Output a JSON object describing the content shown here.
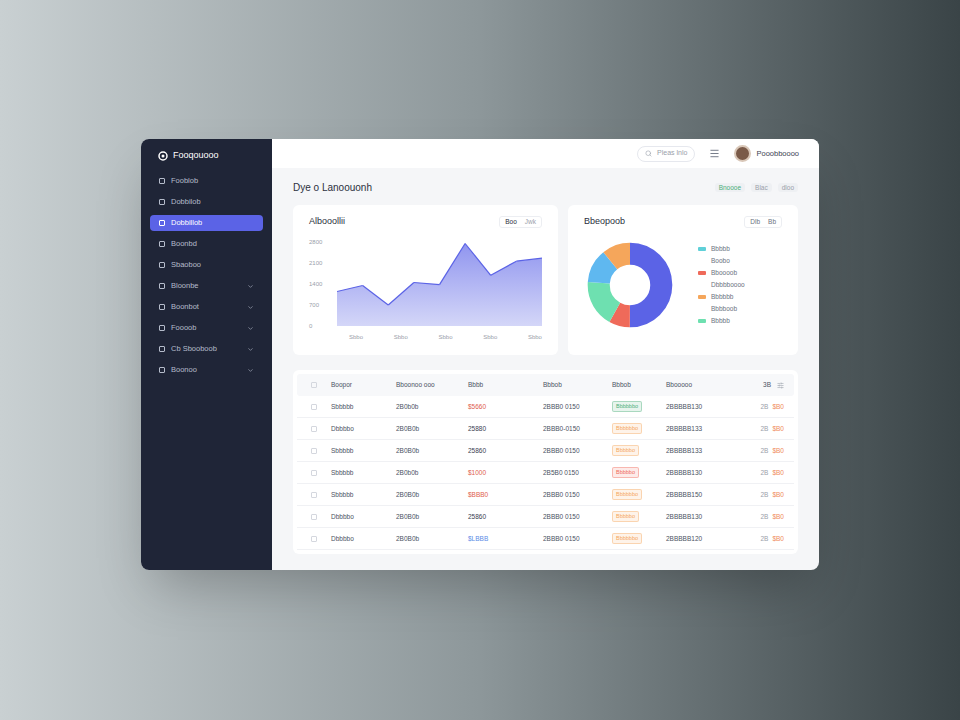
{
  "app": {
    "logo": "Fooqouooo"
  },
  "sidebar": {
    "items": [
      {
        "label": "Fooblob",
        "selected": false,
        "kind": "link"
      },
      {
        "label": "Dobbilob",
        "selected": false,
        "kind": "link"
      },
      {
        "label": "Dobbillob",
        "selected": true,
        "kind": "link"
      },
      {
        "label": "Boonbd",
        "selected": false,
        "kind": "link"
      },
      {
        "label": "Sbaoboo",
        "selected": false,
        "kind": "link"
      },
      {
        "label": "Bloonbe",
        "selected": false,
        "kind": "group"
      },
      {
        "label": "Boonbot",
        "selected": false,
        "kind": "group"
      },
      {
        "label": "Foooob",
        "selected": false,
        "kind": "group"
      },
      {
        "label": "Cb Sbooboob",
        "selected": false,
        "kind": "group"
      },
      {
        "label": "Boonoo",
        "selected": false,
        "kind": "group"
      }
    ]
  },
  "topbar": {
    "search": {
      "placeholder": "Pleas lnlo"
    },
    "user": {
      "name": "Pooobboooo"
    }
  },
  "page": {
    "title": "Dye o Lanoouonh",
    "filters": [
      {
        "label": "Bnoooe",
        "color": "#4caf7a"
      },
      {
        "label": "Blac",
        "color": "#9aa0aa"
      },
      {
        "label": "dloo",
        "color": "#9aa0aa"
      }
    ]
  },
  "line_chart": {
    "title": "Albooollii",
    "toggles": [
      {
        "label": "Boo",
        "selected": true
      },
      {
        "label": "Jwk",
        "selected": false
      }
    ],
    "y_ticks": [
      "2800",
      "2100",
      "1400",
      "700",
      "0"
    ],
    "x_labels": [
      "Sbbo",
      "Sbbo",
      "Sbbo",
      "Sbbo",
      "Sbbo"
    ],
    "series": [
      {
        "values": [
          1150,
          1350,
          700,
          1450,
          1380,
          2750,
          1690,
          2160,
          2260
        ]
      }
    ]
  },
  "donut_chart": {
    "title": "Bbeopoob",
    "buttons": [
      "Dlb",
      "Bb"
    ],
    "segments": [
      {
        "value": 50,
        "color": "#5b63e6"
      },
      {
        "value": 8,
        "color": "#ef6a5a"
      },
      {
        "value": 18,
        "color": "#6ee0b0"
      },
      {
        "value": 13,
        "color": "#5fb8f0"
      },
      {
        "value": 11,
        "color": "#f5a65b"
      }
    ],
    "legend": [
      {
        "label": "Bbbbb",
        "color": "#5fd0d8"
      },
      {
        "label": "Boobo"
      },
      {
        "label": "Bboooob",
        "color": "#ef6a5a"
      },
      {
        "label": "Dbbbboooo"
      },
      {
        "label": "Bbbbbb",
        "color": "#f5a65b"
      },
      {
        "label": "Bbbboob"
      },
      {
        "label": "Bbbbb",
        "color": "#6ee0b0"
      }
    ]
  },
  "table": {
    "columns": [
      "Boopor",
      "Bboonoo ooo",
      "Bbbb",
      "Bbbob",
      "Bbbob",
      "Bbooooo",
      "3B"
    ],
    "rows": [
      {
        "checked": false,
        "cells": [
          "Sbbbbb",
          "2B0b0b",
          "$5660",
          "2BBB0 0150",
          "Bbbbbbo",
          "2BBBBB130",
          "2B",
          "$B0"
        ],
        "amount_color": "#e0604e",
        "status_color": "#4caf7a"
      },
      {
        "checked": false,
        "cells": [
          "Dbbbbo",
          "2B0B0b",
          "25880",
          "2BBB0-0150",
          "Bbbbbbo",
          "2BBBBB133",
          "2B",
          "$B0"
        ],
        "amount_color": "#3b4150",
        "status_color": "#f5a65b"
      },
      {
        "checked": false,
        "cells": [
          "Sbbbbb",
          "2B0B0b",
          "25860",
          "2BBB0 0150",
          "Bbbbbo",
          "2BBBBB133",
          "2B",
          "$B0"
        ],
        "amount_color": "#3b4150",
        "status_color": "#f5a65b"
      },
      {
        "checked": false,
        "cells": [
          "Sbbbbb",
          "2B0b0b",
          "$1000",
          "2B5B0 0150",
          "Bbbbbo",
          "2BBBBB130",
          "2B",
          "$B0"
        ],
        "amount_color": "#e0604e",
        "status_color": "#ef6a5a"
      },
      {
        "checked": false,
        "cells": [
          "Sbbbbb",
          "2B0B0b",
          "$BBB0",
          "2BBB0 0150",
          "Bbbbbbo",
          "2BBBBB150",
          "2B",
          "$B0"
        ],
        "amount_color": "#e0604e",
        "status_color": "#f5a65b"
      },
      {
        "checked": false,
        "cells": [
          "Dbbbbo",
          "2B0B0b",
          "25860",
          "2BBB0 0150",
          "Bbbbbo",
          "2BBBBB130",
          "2B",
          "$B0"
        ],
        "amount_color": "#3b4150",
        "status_color": "#f5a65b"
      },
      {
        "checked": false,
        "cells": [
          "Dbbbbo",
          "2B0B0b",
          "$LBBB",
          "2BBB0 0150",
          "Bbbbbbo",
          "2BBBBB120",
          "2B",
          "$B0"
        ],
        "amount_color": "#5b8be6",
        "status_color": "#f5a65b"
      }
    ]
  }
}
